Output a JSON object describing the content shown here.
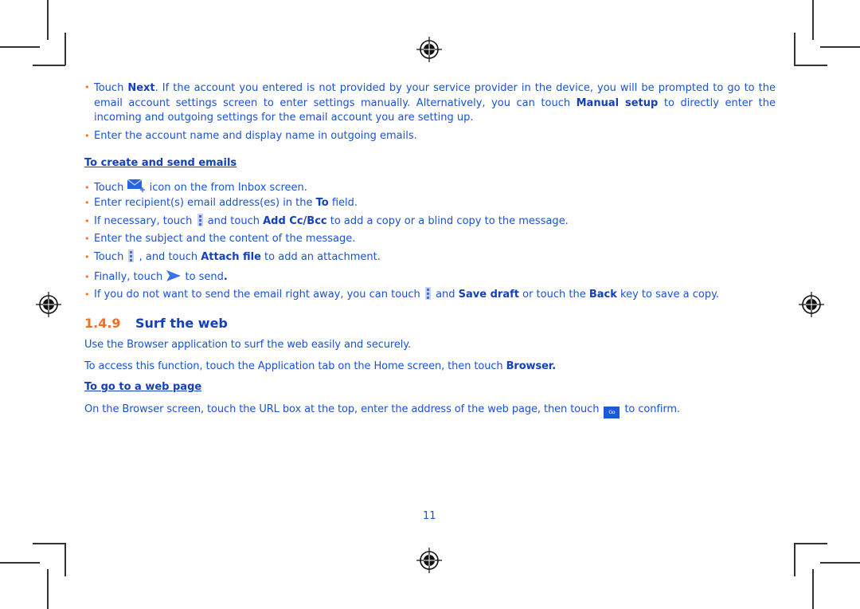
{
  "bullets_top": [
    {
      "parts": [
        "Touch ",
        {
          "b": "Next"
        },
        ". If the account you entered is not provided by your service provider in the device, you will be prompted to go to the email account settings screen to enter settings manually. Alternatively, you can touch ",
        {
          "b": "Manual setup"
        },
        " to directly enter the incoming and outgoing settings for the email account you are setting up."
      ]
    },
    {
      "text": "Enter the account name and display name in outgoing emails."
    }
  ],
  "create_send": {
    "heading": "To create and send emails",
    "b1_pre": "Touch ",
    "b1_post": " icon on the from Inbox screen.",
    "b2_pre": "Enter recipient(s) email address(es) in the ",
    "b2_bold": "To",
    "b2_post": " field.",
    "b3_pre": "If necessary, touch ",
    "b3_mid": " and touch ",
    "b3_bold": "Add Cc/Bcc",
    "b3_post": " to add a copy or a blind copy to the message.",
    "b4": "Enter the subject and the content of the message.",
    "b5_pre": "Touch ",
    "b5_mid": " , and touch ",
    "b5_bold": "Attach file",
    "b5_post": " to add an attachment.",
    "b6_pre": "Finally, touch ",
    "b6_post": " to send",
    "b6_end": ".",
    "b7_pre": "If you do not want to send the email right away, you can touch ",
    "b7_mid": " and ",
    "b7_bold1": "Save draft",
    "b7_mid2": " or touch the ",
    "b7_bold2": "Back",
    "b7_post": " key to save a copy."
  },
  "section": {
    "number": "1.4.9",
    "title": "Surf the web",
    "p1": "Use the Browser application to surf the web easily and securely.",
    "p2_pre": "To access this function, touch the Application tab on the Home screen, then touch ",
    "p2_bold": "Browser.",
    "sub_heading": "To go to a web page",
    "p3_pre": "On the Browser screen, touch the URL box at the top, enter the address of the web page, then touch ",
    "p3_icon": "Go",
    "p3_post": " to confirm."
  },
  "page_number": "11",
  "icons": {
    "compose": "envelope-plus-icon",
    "menu": "overflow-menu-icon",
    "send": "send-icon",
    "go": "go-button-icon",
    "registration": "registration-mark-icon"
  }
}
